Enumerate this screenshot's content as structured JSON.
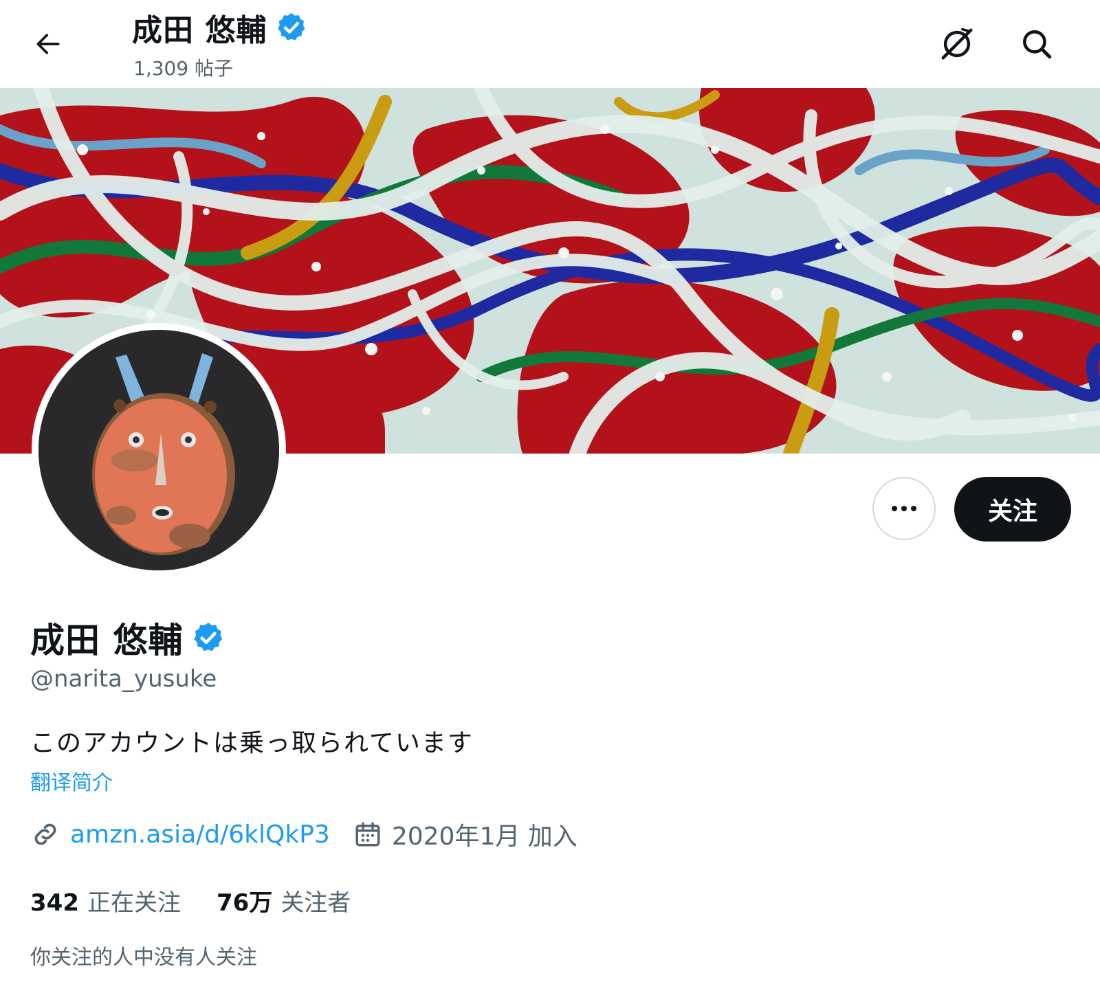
{
  "header": {
    "name": "成田 悠輔",
    "posts_count": "1,309 帖子"
  },
  "profile": {
    "name": "成田 悠輔",
    "handle": "@narita_yusuke",
    "bio": "このアカウントは乗っ取られています",
    "translate_bio": "翻译简介",
    "website": "amzn.asia/d/6klQkP3",
    "joined": "2020年1月 加入",
    "following_count": "342",
    "following_label": "正在关注",
    "followers_count": "76万",
    "followers_label": "关注者",
    "followers_you_know": "你关注的人中没有人关注"
  },
  "actions": {
    "follow_label": "关注"
  },
  "icons": {
    "back": "arrow-left-icon",
    "grok": "grok-icon",
    "search": "search-icon",
    "more": "more-icon",
    "verified": "verified-badge-icon",
    "link": "link-icon",
    "calendar": "calendar-icon"
  },
  "colors": {
    "accent": "#1d9bf0",
    "verified": "#1d9bf0",
    "text": "#0f1419",
    "muted": "#536471",
    "follow_bg": "#0f1419"
  }
}
